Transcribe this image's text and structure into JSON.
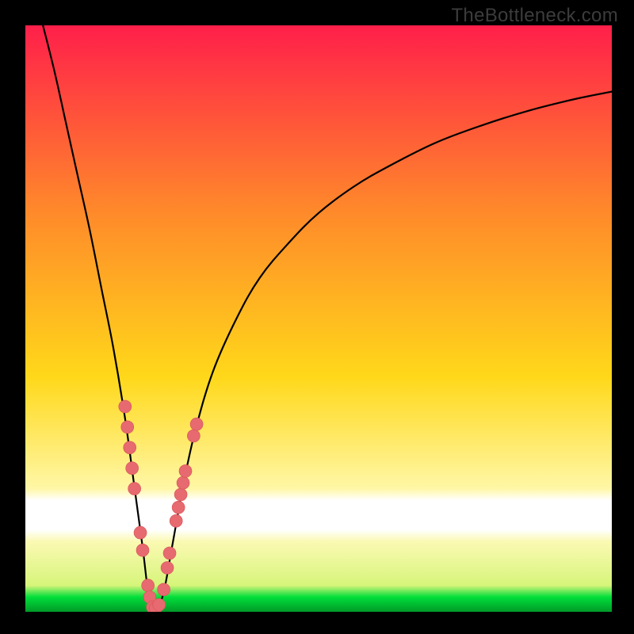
{
  "watermark": "TheBottleneck.com",
  "palette": {
    "black": "#000000",
    "curve": "#000000",
    "dot": "#e66a6f",
    "dot_stroke": "#d85258",
    "grad_top": "#ff1f4a",
    "grad_mid_upper": "#ff8a2a",
    "grad_mid": "#ffd81a",
    "grad_fadeA": "#fff7a6",
    "grad_whiteBand": "#ffffff",
    "grad_below": "#fbf9b3",
    "green": "#00de3a"
  },
  "chart_data": {
    "type": "line",
    "title": "",
    "xlabel": "",
    "ylabel": "",
    "xlim": [
      0,
      100
    ],
    "ylim": [
      0,
      100
    ],
    "series": [
      {
        "name": "bottleneck-curve",
        "x": [
          3,
          5,
          7,
          9,
          11,
          13,
          15,
          17,
          18.5,
          20,
          21,
          22,
          23.5,
          25,
          27,
          29,
          32,
          36,
          40,
          45,
          50,
          56,
          62,
          70,
          78,
          86,
          94,
          100
        ],
        "y": [
          100,
          92,
          83,
          74,
          65,
          55,
          45,
          33,
          22,
          11,
          3,
          0,
          3,
          11,
          22,
          31,
          41,
          50,
          57,
          63,
          68,
          72.5,
          76,
          80,
          83,
          85.5,
          87.5,
          88.7
        ]
      }
    ],
    "markers": [
      {
        "x": 17.0,
        "y": 35.0
      },
      {
        "x": 17.4,
        "y": 31.5
      },
      {
        "x": 17.8,
        "y": 28.0
      },
      {
        "x": 18.2,
        "y": 24.5
      },
      {
        "x": 18.6,
        "y": 21.0
      },
      {
        "x": 19.6,
        "y": 13.5
      },
      {
        "x": 20.0,
        "y": 10.5
      },
      {
        "x": 20.9,
        "y": 4.5
      },
      {
        "x": 21.2,
        "y": 2.5
      },
      {
        "x": 21.7,
        "y": 0.8
      },
      {
        "x": 22.2,
        "y": 0.6
      },
      {
        "x": 22.8,
        "y": 1.2
      },
      {
        "x": 23.6,
        "y": 3.8
      },
      {
        "x": 24.2,
        "y": 7.5
      },
      {
        "x": 24.6,
        "y": 10.0
      },
      {
        "x": 25.7,
        "y": 15.5
      },
      {
        "x": 26.1,
        "y": 17.8
      },
      {
        "x": 26.5,
        "y": 20.0
      },
      {
        "x": 26.9,
        "y": 22.0
      },
      {
        "x": 27.3,
        "y": 24.0
      },
      {
        "x": 28.7,
        "y": 30.0
      },
      {
        "x": 29.2,
        "y": 32.0
      }
    ],
    "marker_radius_px": 8
  }
}
